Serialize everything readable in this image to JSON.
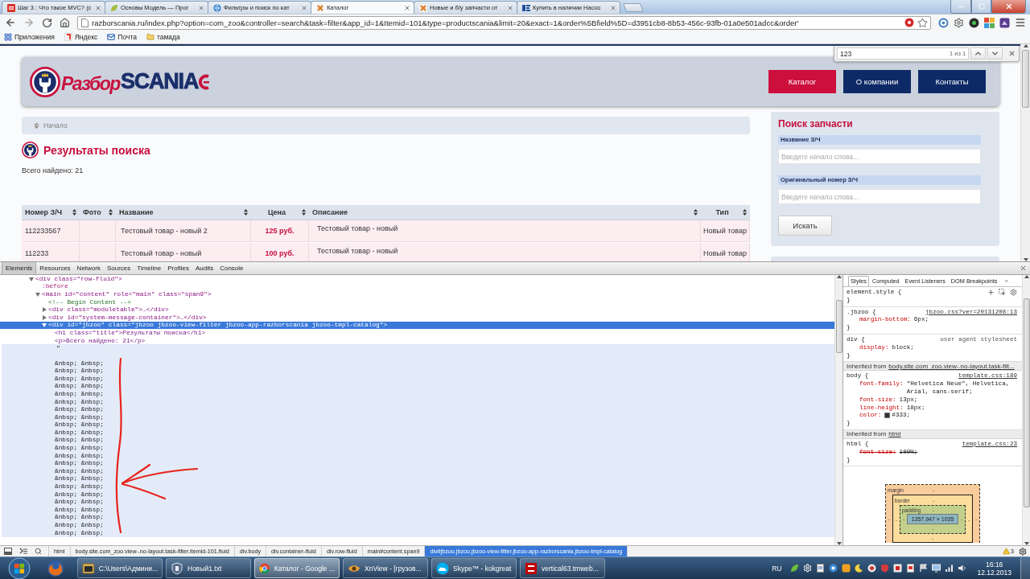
{
  "browser": {
    "tabs": [
      {
        "title": "Шаг 3 : Что такое MVC? (c",
        "kind": "square",
        "selected": false
      },
      {
        "title": "Основы Модель — Прог",
        "kind": "leaf",
        "selected": false
      },
      {
        "title": "Фильтры и поиск по кат",
        "kind": "globe",
        "selected": false
      },
      {
        "title": "Каталог",
        "kind": "cross",
        "selected": true
      },
      {
        "title": "Новые и б/у запчасти от",
        "kind": "cross",
        "selected": false
      },
      {
        "title": "Купить в наличии Насос",
        "kind": "bars",
        "selected": false
      }
    ],
    "address_bar": {
      "url": "razborscania.ru/index.php?option=com_zoo&controller=search&task=filter&app_id=1&Itemid=101&type=productscania&limit=20&exact=1&order%5Bfield%5D=d3951cb8-8b53-456c-93fb-01a0e501adcc&order'"
    },
    "bookmarks": [
      {
        "label": "Приложения",
        "kind": "apps"
      },
      {
        "label": "Яндекс",
        "kind": "site"
      },
      {
        "label": "Почта",
        "kind": "mail"
      },
      {
        "label": "тамада",
        "kind": "folder"
      }
    ]
  },
  "find_bar": {
    "query": "123",
    "matches": "1 из 1"
  },
  "page": {
    "logo": {
      "prefix": "Разбор",
      "brand": "SCANIA"
    },
    "nav": [
      {
        "label": "Каталог",
        "selected": true
      },
      {
        "label": "О компании",
        "selected": false
      },
      {
        "label": "Контакты",
        "selected": false
      }
    ],
    "breadcrumb": [
      "Начало"
    ],
    "heading": "Результаты поиска",
    "total": "Всего найдено: 21",
    "table": {
      "columns": [
        {
          "label": "Номер З/Ч",
          "kind": "number",
          "sortable": true
        },
        {
          "label": "Фото",
          "kind": "photo",
          "sortable": true
        },
        {
          "label": "Название",
          "kind": "name",
          "sortable": true
        },
        {
          "label": "Цена",
          "kind": "price",
          "sortable": true
        },
        {
          "label": "Описание",
          "kind": "description",
          "sortable": true
        },
        {
          "label": "Тип",
          "kind": "type",
          "sortable": true
        }
      ],
      "rows": [
        {
          "number": "112233567",
          "name": "Тестовый товар - новый 2",
          "price": "125 руб.",
          "description": "Тестовый товар - новый",
          "type": "Новый товар"
        },
        {
          "number": "112233",
          "name": "Тестовый товар - новый",
          "price": "100 руб.",
          "description": "Тестовый товар - новый",
          "type": "Новый товар"
        }
      ]
    },
    "sidebar": {
      "title": "Поиск запчасти",
      "fields": [
        {
          "label": "Название З/Ч",
          "placeholder": "Введите начало слова..."
        },
        {
          "label": "Оригинальный номер З/Ч",
          "placeholder": "Введите начало слова..."
        }
      ],
      "button": "Искать"
    }
  },
  "devtools": {
    "tabs": [
      {
        "label": "Elements",
        "selected": true
      },
      {
        "label": "Resources",
        "selected": false
      },
      {
        "label": "Network",
        "selected": false
      },
      {
        "label": "Sources",
        "selected": false
      },
      {
        "label": "Timeline",
        "selected": false
      },
      {
        "label": "Profiles",
        "selected": false
      },
      {
        "label": "Audits",
        "selected": false
      },
      {
        "label": "Console",
        "selected": false
      }
    ],
    "dom_tree": [
      {
        "kind": "element",
        "markup": "<div class=\"row-fluid\">",
        "expanded": true,
        "selected": false,
        "hovered": false,
        "children": [
          {
            "kind": "pseudo",
            "markup": ":before",
            "selected": false,
            "hovered": false
          },
          {
            "kind": "element",
            "markup": "<main id=\"content\" role=\"main\" class=\"span9\">",
            "expanded": true,
            "selected": false,
            "hovered": false,
            "children": [
              {
                "kind": "comment",
                "markup": "<!-- Begin Content -->",
                "selected": false,
                "hovered": false
              },
              {
                "kind": "element",
                "markup": "<div class=\"moduletable\">…</div>",
                "expanded": false,
                "selected": false,
                "hovered": false
              },
              {
                "kind": "element",
                "markup": "<div id=\"system-message-container\">…</div>",
                "expanded": false,
                "selected": false,
                "hovered": false
              },
              {
                "kind": "element",
                "markup": "<div id=\"jbzoo\" class=\"jbzoo jbzoo-view-filter jbzoo-app-razborscania jbzoo-tmpl-catalog\">",
                "expanded": true,
                "selected": true,
                "hovered": false,
                "children": [
                  {
                    "kind": "inline",
                    "markup": "<h1 class=\"title\">Результаты поиска</h1>",
                    "selected": false,
                    "hovered": false
                  },
                  {
                    "kind": "inline",
                    "markup": "<p>Всего найдено: 21</p>",
                    "selected": false,
                    "hovered": false
                  },
                  {
                    "kind": "text",
                    "markup": "\"",
                    "selected": false,
                    "hovered": true,
                    "lines": [
                      "&nbsp; &nbsp;",
                      "&nbsp; &nbsp;",
                      "&nbsp; &nbsp;",
                      "&nbsp; &nbsp;",
                      "&nbsp; &nbsp;",
                      "&nbsp; &nbsp;",
                      "&nbsp; &nbsp;",
                      "&nbsp; &nbsp;",
                      "&nbsp; &nbsp;",
                      "&nbsp; &nbsp;",
                      "&nbsp; &nbsp;",
                      "&nbsp; &nbsp;",
                      "&nbsp; &nbsp;",
                      "&nbsp; &nbsp;",
                      "&nbsp; &nbsp;",
                      "&nbsp; &nbsp;",
                      "&nbsp; &nbsp;",
                      "&nbsp; &nbsp;",
                      "&nbsp; &nbsp;",
                      "&nbsp; &nbsp;",
                      "&nbsp; &nbsp;",
                      "&nbsp; &nbsp;",
                      "&nbsp; &nbsp;"
                    ]
                  }
                ]
              }
            ]
          }
        ]
      }
    ],
    "styles": {
      "tabs": [
        {
          "label": "Styles",
          "selected": true
        },
        {
          "label": "Computed",
          "selected": false
        },
        {
          "label": "Event Listeners",
          "selected": false
        },
        {
          "label": "DOM Breakpoints",
          "selected": false
        }
      ],
      "more": "»",
      "sections": [
        {
          "kind": "inline",
          "selector": "element.style {",
          "end": "}"
        },
        {
          "kind": "rule",
          "selector": ".jbzoo {",
          "source": "jbzoo.css?ver=20131208:13",
          "source_link": true,
          "end": "}",
          "properties": [
            {
              "name": "margin-bottom:",
              "value": "6px;",
              "overridden": false
            }
          ]
        },
        {
          "kind": "rule",
          "selector": "div {",
          "source": "user agent stylesheet",
          "source_link": false,
          "end": "}",
          "properties": [
            {
              "name": "display:",
              "value": "block;",
              "overridden": false
            }
          ]
        },
        {
          "kind": "inherited",
          "label": "Inherited from",
          "link": "body.site.com_zoo.view-.no-layout.task-filt..."
        },
        {
          "kind": "rule",
          "selector": "body {",
          "source": "template.css:189",
          "source_link": true,
          "end": "}",
          "properties": [
            {
              "name": "font-family:",
              "value": "\"Helvetica Neue\", Helvetica, Arial, sans-serif;",
              "overridden": false
            },
            {
              "name": "font-size:",
              "value": "13px;",
              "overridden": false
            },
            {
              "name": "line-height:",
              "value": "18px;",
              "overridden": false
            },
            {
              "name": "color:",
              "value": "#333;",
              "color": "#333333",
              "overridden": false
            }
          ]
        },
        {
          "kind": "inherited",
          "label": "Inherited from",
          "link": "html"
        },
        {
          "kind": "rule",
          "selector": "html {",
          "source": "template.css:23",
          "source_link": true,
          "end": "}",
          "properties": [
            {
              "name": "font-size:",
              "value": "100%;",
              "overridden": true
            }
          ]
        }
      ],
      "box_model": {
        "margin": {
          "label": "margin",
          "top": "-",
          "left": "-",
          "right": "-"
        },
        "border": {
          "label": "border",
          "top": "-",
          "left": "-",
          "right": "-",
          "bottom": "-"
        },
        "padding": {
          "label": "padding",
          "top": "-",
          "left": "-",
          "right": "-",
          "bottom": "-"
        },
        "content": "1357.947 × 1035"
      }
    },
    "breadcrumbs": [
      {
        "label": "html",
        "selected": false
      },
      {
        "label": "body.site.com_zoo.view-.no-layout.task-filter.itemid-101.fluid",
        "selected": false
      },
      {
        "label": "div.body",
        "selected": false
      },
      {
        "label": "div.container-fluid",
        "selected": false
      },
      {
        "label": "div.row-fluid",
        "selected": false
      },
      {
        "label": "main#content.span9",
        "selected": false
      },
      {
        "label": "div#jbzoo.jbzoo.jbzoo-view-filter.jbzoo-app-razborscania.jbzoo-tmpl-catalog",
        "selected": true
      }
    ],
    "warnings": "3"
  },
  "taskbar": {
    "tasks": [
      {
        "label": "C:\\Users\\Админи...",
        "kind": "folder",
        "selected": false
      },
      {
        "label": "Новый1.txt",
        "kind": "notepad",
        "selected": false
      },
      {
        "label": "Каталог - Google ...",
        "kind": "browser",
        "selected": true
      },
      {
        "label": "XnView - [грузов...",
        "kind": "viewer",
        "selected": false
      },
      {
        "label": "Skype™ - kokgreat",
        "kind": "chat",
        "selected": false
      },
      {
        "label": "vertical63.tmweb...",
        "kind": "ftp",
        "selected": false
      }
    ],
    "language": "RU",
    "time": "16:16",
    "date": "12.12.2013"
  }
}
